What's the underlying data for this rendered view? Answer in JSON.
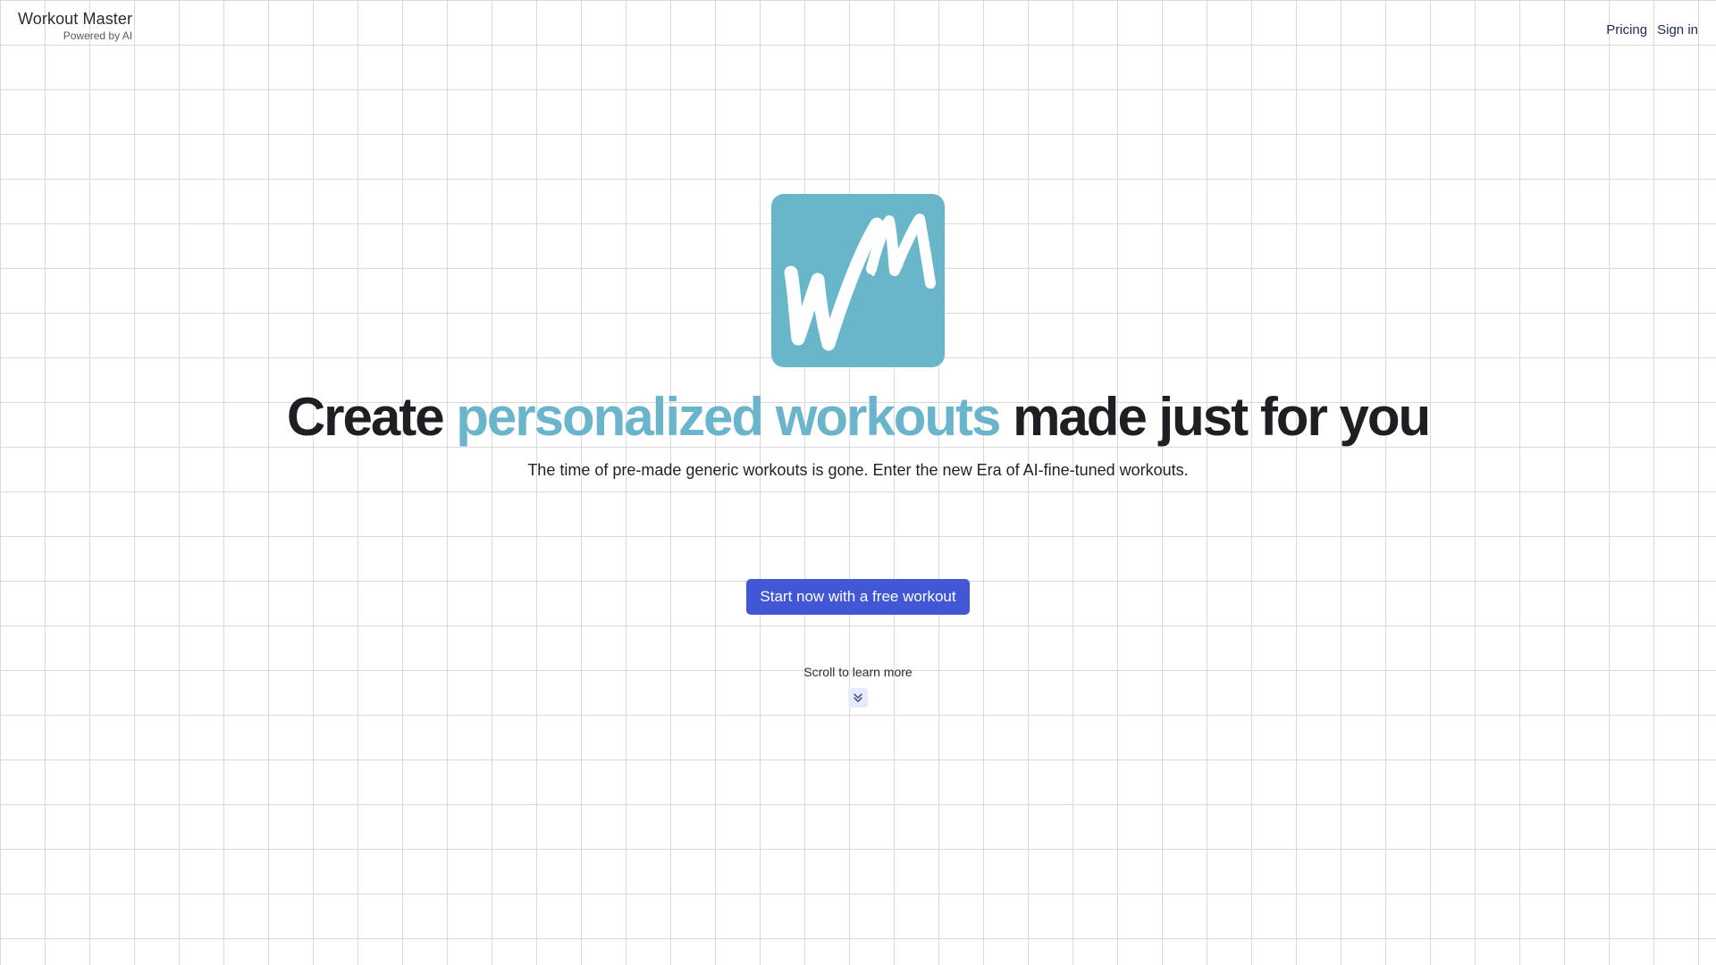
{
  "header": {
    "brand_title": "Workout Master",
    "brand_subtitle": "Powered by AI",
    "nav": {
      "pricing": "Pricing",
      "sign_in": "Sign in"
    }
  },
  "hero": {
    "logo_icon": "workout-master-logo-icon",
    "logo_color": "#69b6cb",
    "headline": {
      "before": "Create ",
      "accent": "personalized workouts",
      "after": " made just for you"
    },
    "accent_color": "#6ab4cc",
    "subtitle": "The time of pre-made generic workouts is gone. Enter the new Era of AI-fine-tuned workouts.",
    "cta_label": "Start now with a free workout",
    "cta_color": "#4257d6",
    "scroll_hint": "Scroll to learn more",
    "scroll_icon": "chevrons-down-icon"
  }
}
